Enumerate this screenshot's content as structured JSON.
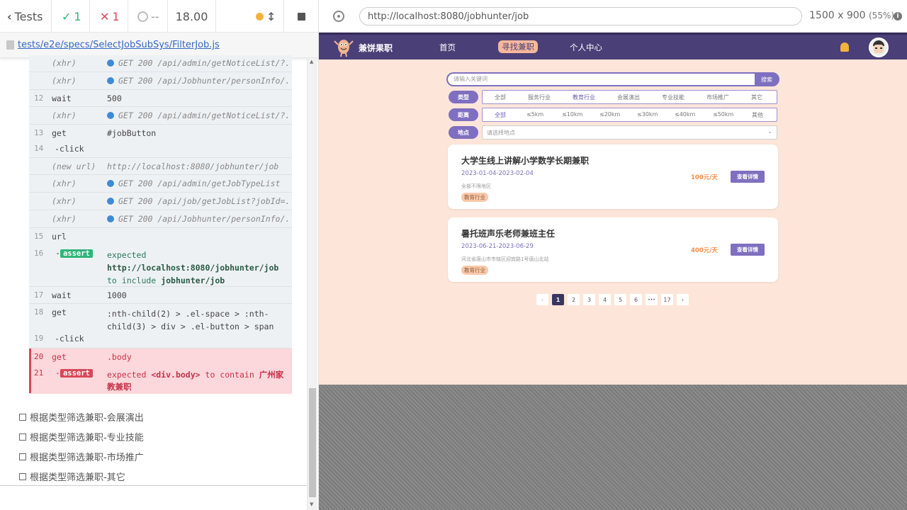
{
  "reporter": {
    "tests_label": "Tests",
    "passed": "1",
    "failed": "1",
    "pending": "--",
    "duration": "18.00",
    "spec_path": "tests/e2e/specs/SelectJobSubSys/FilterJob.js"
  },
  "commands": [
    {
      "num": "",
      "name": "(xhr)",
      "msg": "GET 200 /api/admin/getNoticeList/?...",
      "italic": true,
      "dot": true
    },
    {
      "num": "",
      "name": "(xhr)",
      "msg": "GET 200 /api/Jobhunter/personInfo/...",
      "italic": true,
      "dot": true
    },
    {
      "num": "12",
      "name": "wait",
      "msg": "500"
    },
    {
      "num": "",
      "name": "(xhr)",
      "msg": "GET 200 /api/admin/getNoticeList/?...",
      "italic": true,
      "dot": true
    },
    {
      "num": "13",
      "name": "get",
      "msg": "#jobButton"
    },
    {
      "num": "14",
      "name": "-click",
      "msg": ""
    },
    {
      "num": "",
      "name": "(new url)",
      "msg": "http://localhost:8080/jobhunter/job",
      "italic": true
    },
    {
      "num": "",
      "name": "(xhr)",
      "msg": "GET 200 /api/admin/getJobTypeList",
      "italic": true,
      "dot": true
    },
    {
      "num": "",
      "name": "(xhr)",
      "msg": "GET 200 /api/job/getJobList?jobId=...",
      "italic": true,
      "dot": true
    },
    {
      "num": "",
      "name": "(xhr)",
      "msg": "GET 200 /api/Jobhunter/personInfo/...",
      "italic": true,
      "dot": true
    },
    {
      "num": "15",
      "name": "url",
      "msg": ""
    },
    {
      "num": "17",
      "name": "wait",
      "msg": "1000"
    },
    {
      "num": "18",
      "name": "get",
      "msg": ":nth-child(2) > .el-space > :nth-",
      "msg2": "child(3) > div > .el-button > span"
    },
    {
      "num": "19",
      "name": "-click",
      "msg": ""
    },
    {
      "num": "20",
      "name": "get",
      "msg": ".body"
    }
  ],
  "assert_pass": {
    "num": "16",
    "badge": "assert",
    "line1": "expected",
    "line2": "http://localhost:8080/jobhunter/job",
    "line3a": "to include",
    "line3b": "jobhunter/job"
  },
  "assert_fail": {
    "num": "21",
    "badge": "assert",
    "line1a": "expected",
    "line1b": "<div.body>",
    "line1c": "to contain",
    "line1d": "广州家",
    "line2": "教兼职"
  },
  "tests": [
    "根据类型筛选兼职-会展演出",
    "根据类型筛选兼职-专业技能",
    "根据类型筛选兼职-市场推广",
    "根据类型筛选兼职-其它"
  ],
  "preview": {
    "url": "http://localhost:8080/jobhunter/job",
    "viewport": "1500 x 900",
    "scale": "(55%)"
  },
  "app": {
    "brand": "兼饼果职",
    "nav": [
      "首页",
      "寻找兼职",
      "个人中心"
    ],
    "search_placeholder": "请输入关键词",
    "search_button": "搜索",
    "filters": {
      "type_label": "类型",
      "type_options": [
        "全部",
        "服务行业",
        "教育行业",
        "会展演出",
        "专业技能",
        "市场推广",
        "其它"
      ],
      "distance_label": "距离",
      "distance_options": [
        "全部",
        "≤5km",
        "≤10km",
        "≤20km",
        "≤30km",
        "≤40km",
        "≤50km",
        "其他"
      ],
      "place_label": "地点",
      "place_placeholder": "请选择地点"
    },
    "jobs": [
      {
        "title": "大学生线上讲解小学数学长期兼职",
        "dates": "2023-01-04-2023-02-04",
        "location": "全部不限地区",
        "tag": "教育行业",
        "pay": "100元/天",
        "button": "查看详情"
      },
      {
        "title": "暑托班声乐老师兼班主任",
        "dates": "2023-06-21-2023-06-29",
        "location": "河北省唐山市市辖区迎宾路1号唐山北站",
        "tag": "教育行业",
        "pay": "400元/天",
        "button": "查看详情"
      }
    ],
    "pages": [
      "‹",
      "1",
      "2",
      "3",
      "4",
      "5",
      "6",
      "•••",
      "17",
      "›"
    ]
  }
}
